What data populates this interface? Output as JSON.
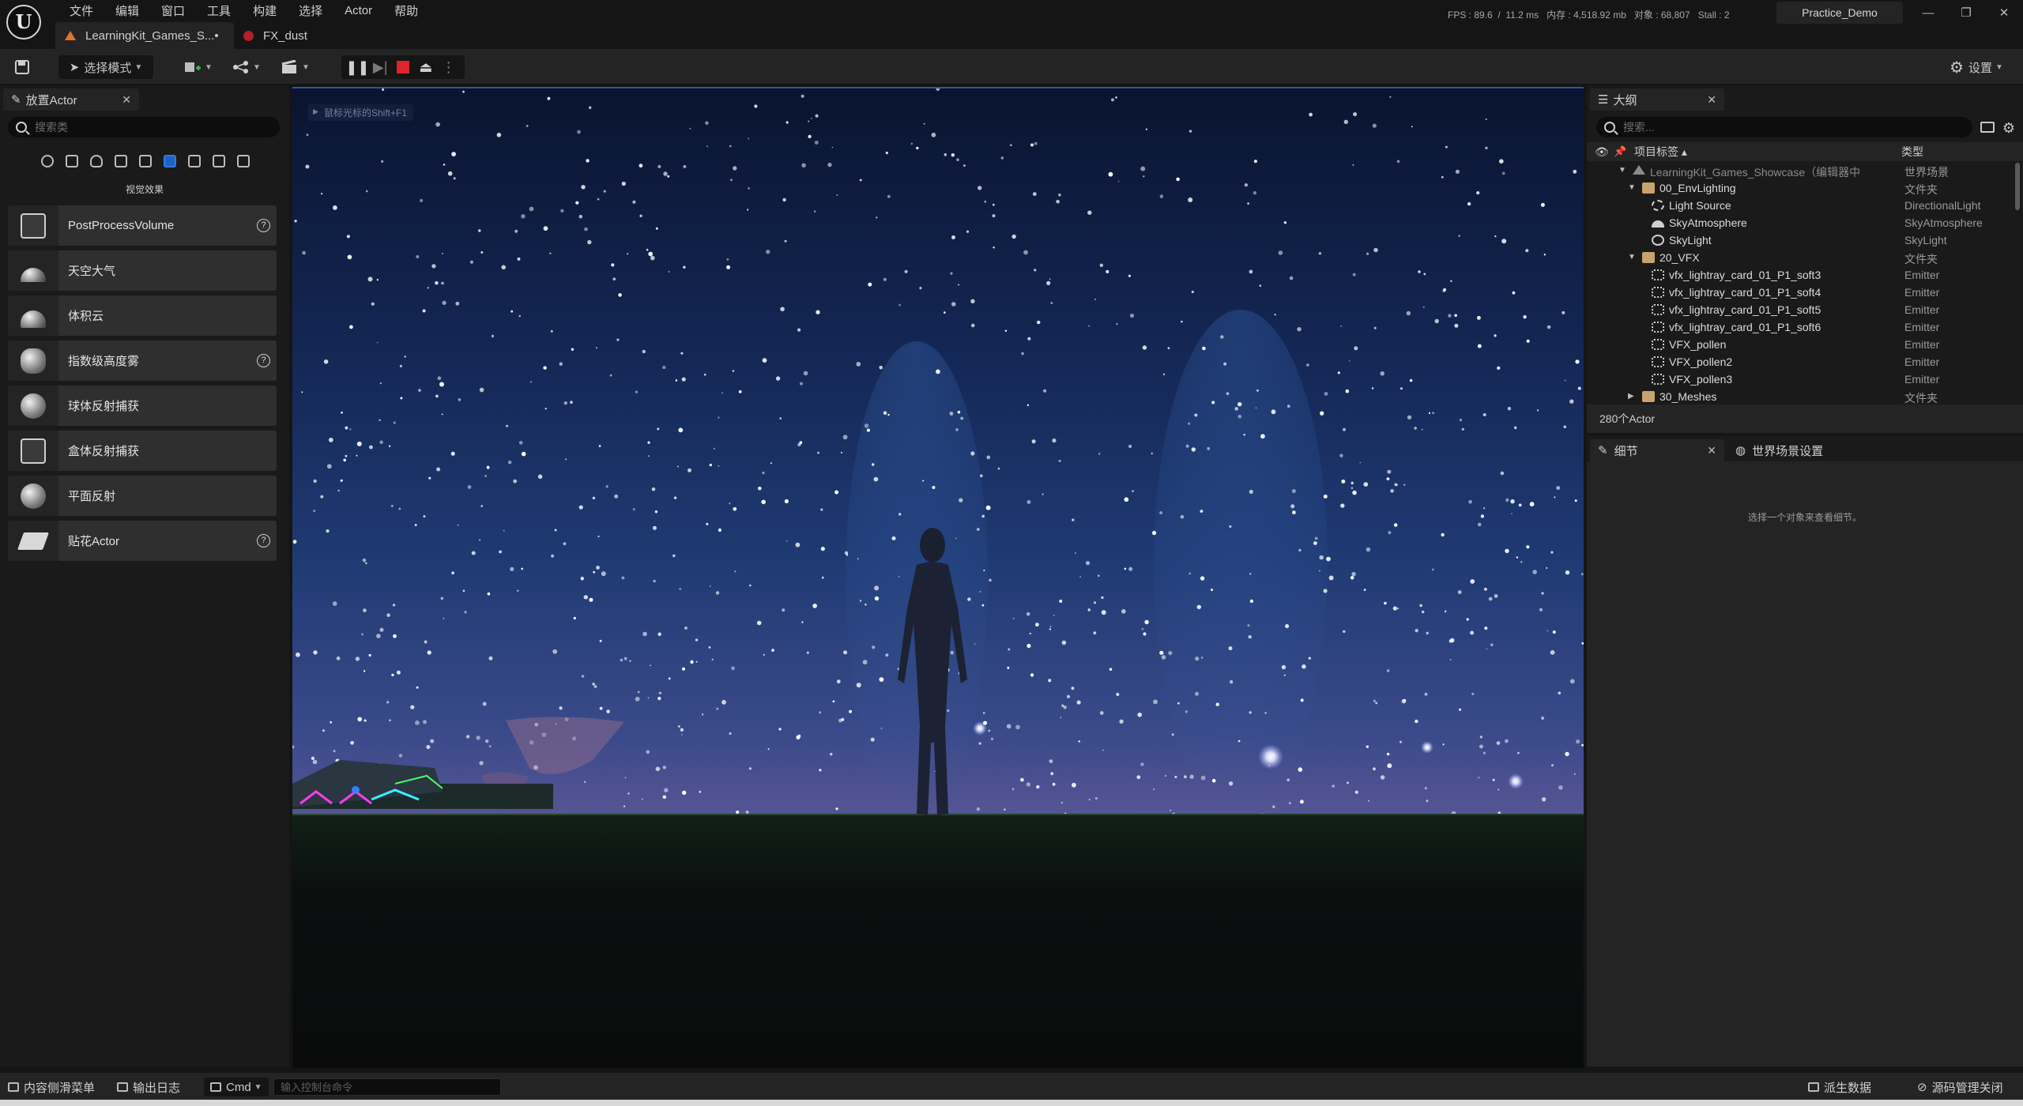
{
  "app": {
    "menu": [
      "文件",
      "编辑",
      "窗口",
      "工具",
      "构建",
      "选择",
      "Actor",
      "帮助"
    ],
    "tabs": [
      {
        "label": "LearningKit_Games_S...•",
        "active": true
      },
      {
        "label": "FX_dust",
        "active": false
      }
    ],
    "stats": "FPS : 89.6  /  11.2 ms   内存 : 4,518.92 mb   对象 : 68,807   Stall : 2",
    "project": "Practice_Demo",
    "window_controls": [
      "—",
      "❐",
      "✕"
    ]
  },
  "toolbar": {
    "select_mode": "选择模式",
    "settings": "设置"
  },
  "place_actors": {
    "tab": "放置Actor",
    "search_placeholder": "搜索类",
    "category_icons": [
      "recent-icon",
      "basic-icon",
      "lights-icon",
      "shapes-icon",
      "cinematic-icon",
      "visual-effects-icon",
      "volumes-icon",
      "all-classes-icon",
      "geometry-icon"
    ],
    "active_category": "视觉效果",
    "items": [
      {
        "label": "PostProcessVolume",
        "help": true,
        "icon": "post-process-icon"
      },
      {
        "label": "天空大气",
        "help": false,
        "icon": "sky-atmosphere-icon"
      },
      {
        "label": "体积云",
        "help": false,
        "icon": "volumetric-cloud-icon"
      },
      {
        "label": "指数级高度雾",
        "help": true,
        "icon": "height-fog-icon"
      },
      {
        "label": "球体反射捕获",
        "help": false,
        "icon": "sphere-reflection-icon"
      },
      {
        "label": "盒体反射捕获",
        "help": false,
        "icon": "box-reflection-icon"
      },
      {
        "label": "平面反射",
        "help": false,
        "icon": "planar-reflection-icon"
      },
      {
        "label": "贴花Actor",
        "help": true,
        "icon": "decal-icon"
      }
    ]
  },
  "viewport": {
    "hint": "鼠标光标的Shift+F1"
  },
  "outliner": {
    "tab": "大纲",
    "search_placeholder": "搜索...",
    "col_label": "项目标签 ▴",
    "col_type": "类型",
    "rows": [
      {
        "label": "LearningKit_Games_Showcase（编辑器中",
        "type": "世界场景",
        "indent": 0,
        "arrow": "▼",
        "icon": "world",
        "dim": true
      },
      {
        "label": "00_EnvLighting",
        "type": "文件夹",
        "indent": 1,
        "arrow": "▼",
        "icon": "folder"
      },
      {
        "label": "Light Source",
        "type": "DirectionalLight",
        "indent": 2,
        "arrow": "",
        "icon": "light"
      },
      {
        "label": "SkyAtmosphere",
        "type": "SkyAtmosphere",
        "indent": 2,
        "arrow": "",
        "icon": "sky"
      },
      {
        "label": "SkyLight",
        "type": "SkyLight",
        "indent": 2,
        "arrow": "",
        "icon": "skylight"
      },
      {
        "label": "20_VFX",
        "type": "文件夹",
        "indent": 1,
        "arrow": "▼",
        "icon": "folder"
      },
      {
        "label": "vfx_lightray_card_01_P1_soft3",
        "type": "Emitter",
        "indent": 2,
        "arrow": "",
        "icon": "emitter"
      },
      {
        "label": "vfx_lightray_card_01_P1_soft4",
        "type": "Emitter",
        "indent": 2,
        "arrow": "",
        "icon": "emitter"
      },
      {
        "label": "vfx_lightray_card_01_P1_soft5",
        "type": "Emitter",
        "indent": 2,
        "arrow": "",
        "icon": "emitter"
      },
      {
        "label": "vfx_lightray_card_01_P1_soft6",
        "type": "Emitter",
        "indent": 2,
        "arrow": "",
        "icon": "emitter"
      },
      {
        "label": "VFX_pollen",
        "type": "Emitter",
        "indent": 2,
        "arrow": "",
        "icon": "emitter"
      },
      {
        "label": "VFX_pollen2",
        "type": "Emitter",
        "indent": 2,
        "arrow": "",
        "icon": "emitter"
      },
      {
        "label": "VFX_pollen3",
        "type": "Emitter",
        "indent": 2,
        "arrow": "",
        "icon": "emitter"
      },
      {
        "label": "30_Meshes",
        "type": "文件夹",
        "indent": 1,
        "arrow": "▶",
        "icon": "folder"
      }
    ],
    "footer": "280个Actor"
  },
  "details": {
    "tab": "细节",
    "world_tab": "世界场景设置",
    "empty": "选择一个对象来查看细节。"
  },
  "statusbar": {
    "content_drawer": "内容侧滑菜单",
    "output_log": "输出日志",
    "cmd": "Cmd",
    "console_placeholder": "输入控制台命令",
    "derived_data": "派生数据",
    "source_control": "源码管理关闭"
  }
}
